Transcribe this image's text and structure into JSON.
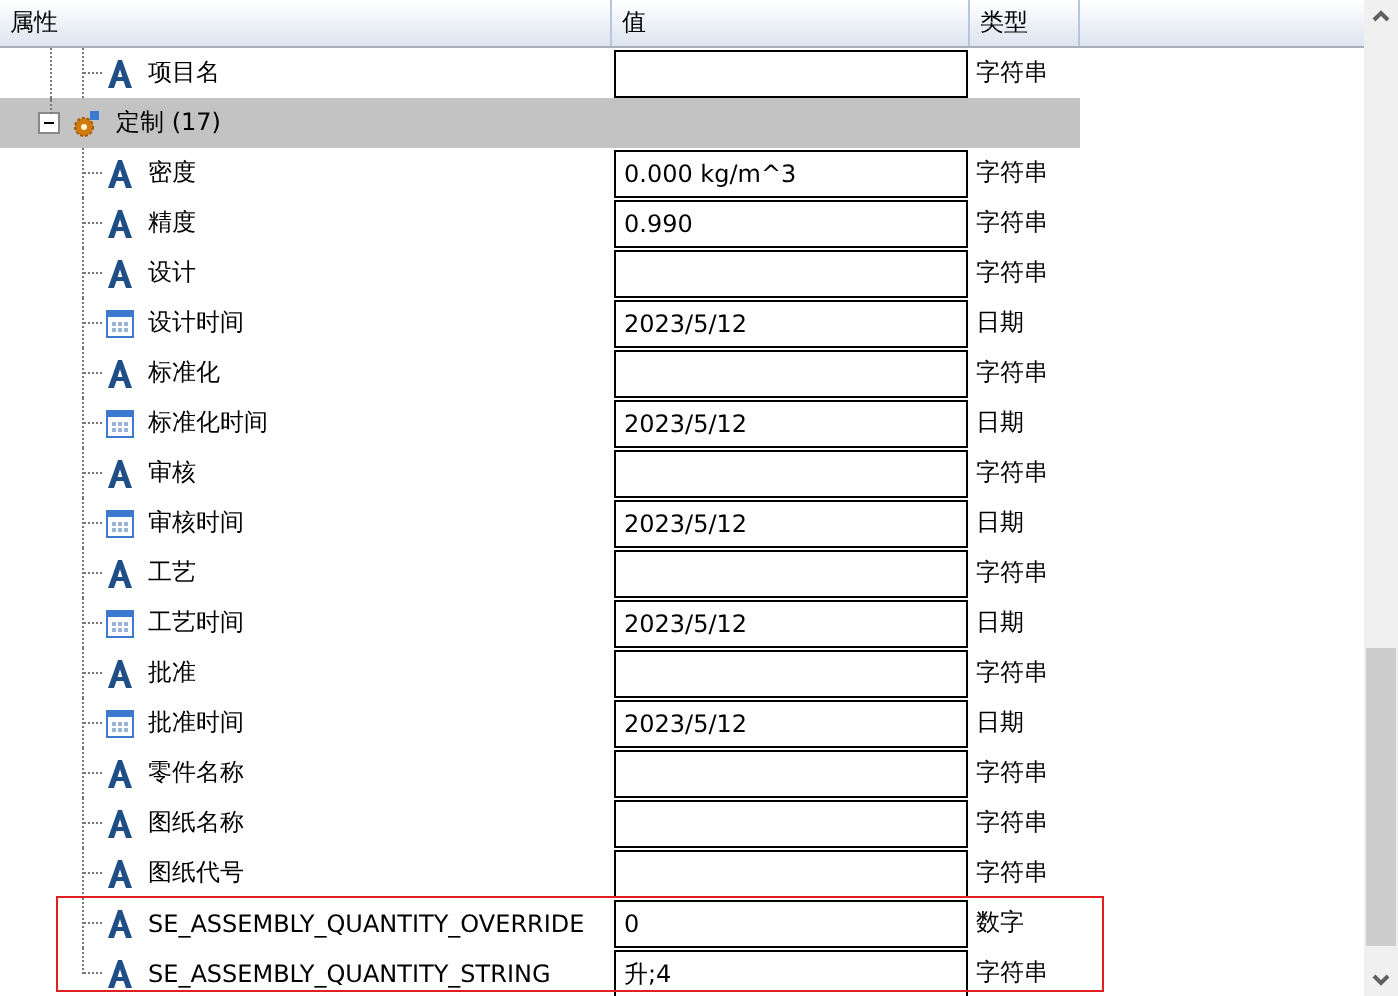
{
  "columns": [
    {
      "label": "属性"
    },
    {
      "label": "值"
    },
    {
      "label": "类型"
    }
  ],
  "rows": [
    {
      "kind": "text",
      "name": "项目名",
      "type": "字符串",
      "highlighted": false
    }
  ],
  "group": {
    "label": "定制 (17)",
    "expanded": true,
    "selected": true,
    "children": [
      {
        "kind": "text",
        "name": "密度",
        "value": "0.000 kg/m^3",
        "type": "字符串",
        "highlighted": false
      },
      {
        "kind": "text",
        "name": "精度",
        "value": "0.990",
        "type": "字符串",
        "highlighted": false
      },
      {
        "kind": "text",
        "name": "设计",
        "type": "字符串",
        "highlighted": false
      },
      {
        "kind": "date",
        "name": "设计时间",
        "value": "2023/5/12",
        "type": "日期",
        "highlighted": false
      },
      {
        "kind": "text",
        "name": "标准化",
        "type": "字符串",
        "highlighted": false
      },
      {
        "kind": "date",
        "name": "标准化时间",
        "value": "2023/5/12",
        "type": "日期",
        "highlighted": false
      },
      {
        "kind": "text",
        "name": "审核",
        "type": "字符串",
        "highlighted": false
      },
      {
        "kind": "date",
        "name": "审核时间",
        "value": "2023/5/12",
        "type": "日期",
        "highlighted": false
      },
      {
        "kind": "text",
        "name": "工艺",
        "type": "字符串",
        "highlighted": false
      },
      {
        "kind": "date",
        "name": "工艺时间",
        "value": "2023/5/12",
        "type": "日期",
        "highlighted": false
      },
      {
        "kind": "text",
        "name": "批准",
        "type": "字符串",
        "highlighted": false
      },
      {
        "kind": "date",
        "name": "批准时间",
        "value": "2023/5/12",
        "type": "日期",
        "highlighted": false
      },
      {
        "kind": "text",
        "name": "零件名称",
        "type": "字符串",
        "highlighted": false
      },
      {
        "kind": "text",
        "name": "图纸名称",
        "type": "字符串",
        "highlighted": false
      },
      {
        "kind": "text",
        "name": "图纸代号",
        "type": "字符串",
        "highlighted": false
      },
      {
        "kind": "text",
        "name": "SE_ASSEMBLY_QUANTITY_OVERRIDE",
        "value": "0",
        "type": "数字",
        "highlighted": true
      },
      {
        "kind": "text",
        "name": "SE_ASSEMBLY_QUANTITY_STRING",
        "value": "升;4",
        "type": "字符串",
        "highlighted": true
      }
    ]
  }
}
